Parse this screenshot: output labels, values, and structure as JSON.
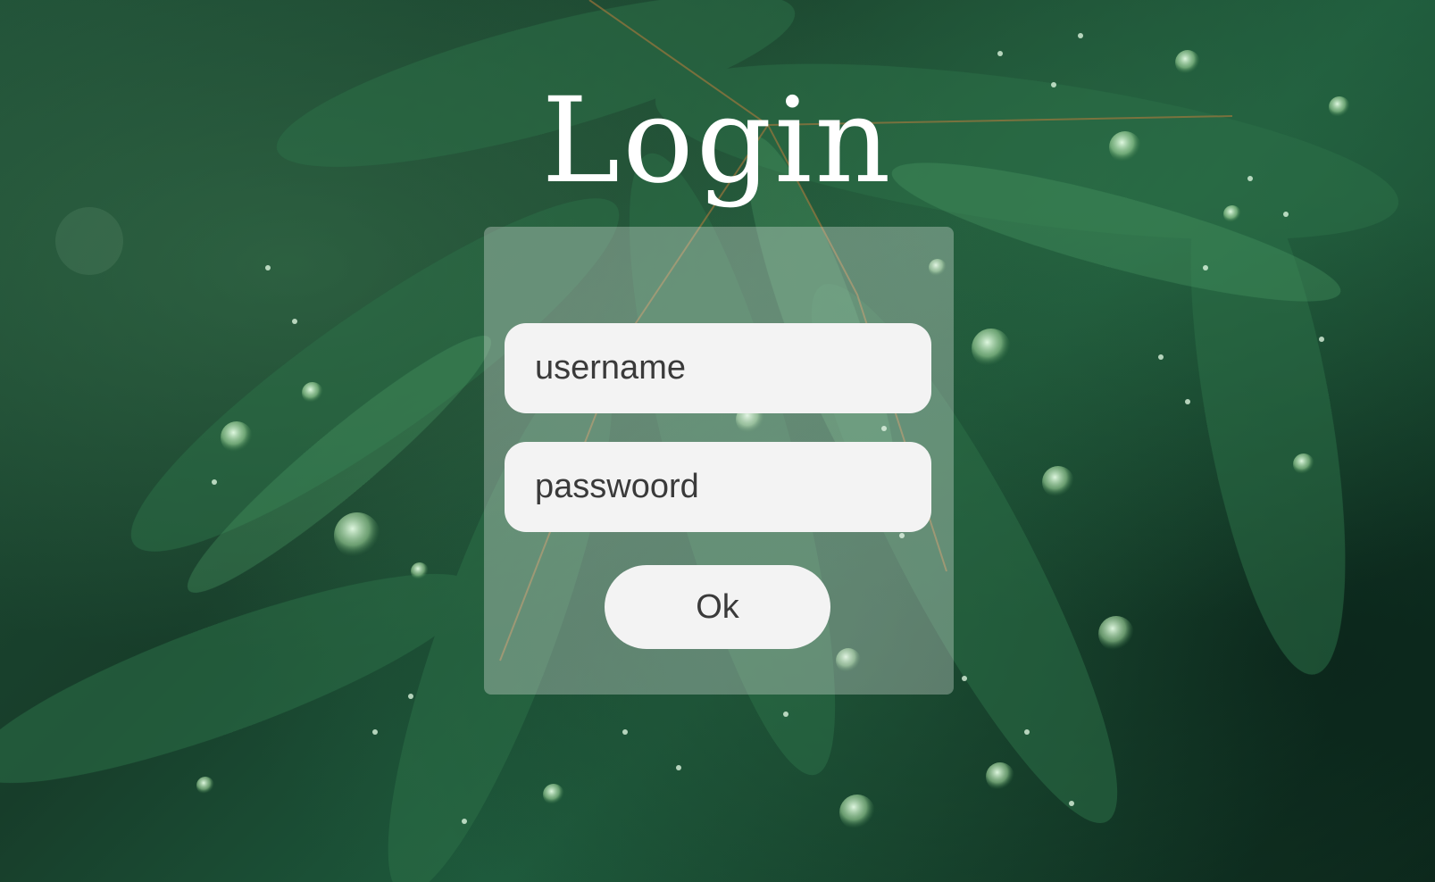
{
  "page": {
    "title": "Login"
  },
  "form": {
    "username_placeholder": "username",
    "password_placeholder": "passwoord",
    "submit_label": "Ok"
  },
  "colors": {
    "background_primary": "#173d2a",
    "panel_overlay": "rgba(235,240,236,0.32)",
    "field_background": "#f3f3f3",
    "text_dark": "#3a3a3a",
    "title_color": "#ffffff"
  },
  "background": {
    "subject": "leaf-with-water-droplets-image"
  }
}
